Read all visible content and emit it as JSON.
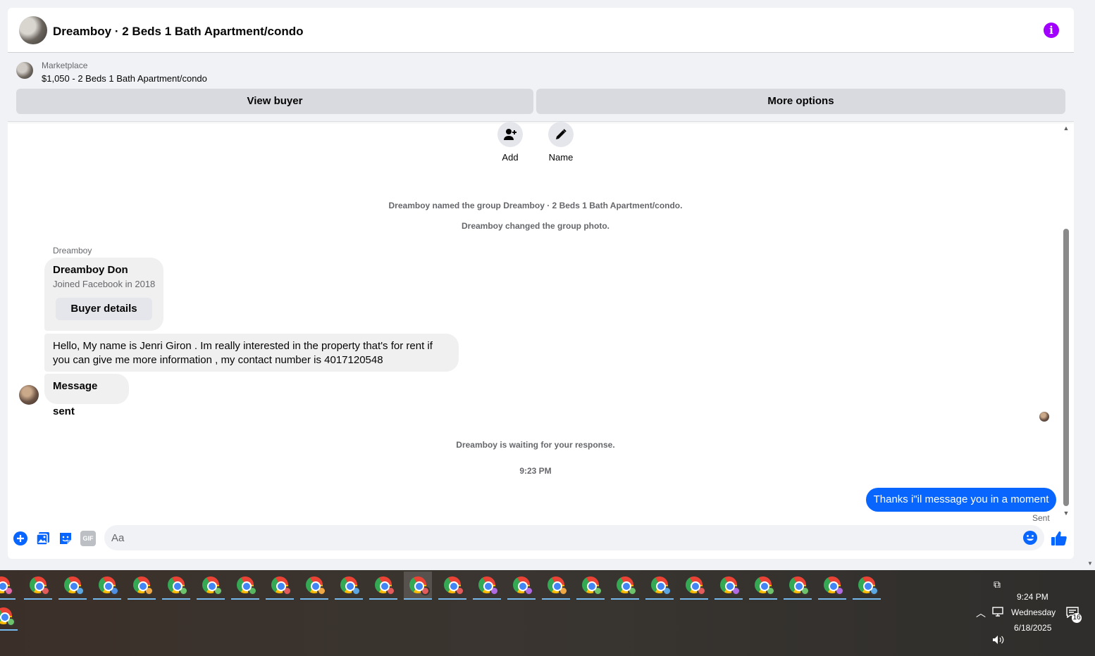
{
  "header": {
    "title": "Dreamboy · 2 Beds 1 Bath Apartment/condo",
    "info_icon": "i"
  },
  "listing": {
    "source": "Marketplace",
    "price_title": "$1,050 - 2 Beds 1 Bath Apartment/condo",
    "view_buyer_label": "View buyer",
    "more_options_label": "More options"
  },
  "quick_actions": {
    "add_label": "Add",
    "name_label": "Name"
  },
  "system": {
    "named_group": "Dreamboy named the group Dreamboy · 2 Beds 1 Bath Apartment/condo.",
    "changed_photo": "Dreamboy changed the group photo.",
    "waiting": "Dreamboy is waiting for your response.",
    "timestamp": "9:23 PM"
  },
  "thread": {
    "sender_name": "Dreamboy",
    "card": {
      "name": "Dreamboy Don",
      "joined": "Joined Facebook in 2018",
      "button": "Buyer details"
    },
    "incoming_message": "Hello, My name is Jenri Giron . Im really interested in the property that's for rent if you can give me more information , my contact number is 4017120548",
    "message_sent": "Message sent",
    "outgoing_message": "Thanks i\"il message you in a moment",
    "outgoing_status": "Sent"
  },
  "composer": {
    "placeholder": "Aa",
    "gif_label": "GIF"
  },
  "taskbar": {
    "time": "9:24 PM",
    "day": "Wednesday",
    "date": "6/18/2025",
    "notification_count": "16",
    "profile_colors": [
      "#e46aa8",
      "#e35b5b",
      "#5ba7e3",
      "#4f8fe3",
      "#f0a844",
      "#6cc36c",
      "#6cc36c",
      "#57b65f",
      "#e35b5b",
      "#f0a844",
      "#5ba7e3",
      "#e35b5b",
      "#e35b5b",
      "#e35b5b",
      "#b06ae4",
      "#b06ae4",
      "#f0a844",
      "#6cc36c",
      "#6cc36c",
      "#5ba7e3",
      "#e35b5b",
      "#b06ae4",
      "#6cc36c",
      "#6cc36c",
      "#b06ae4",
      "#5ba7e3",
      "#6cc36c"
    ]
  },
  "colors": {
    "accent_blue": "#0866ff",
    "info_purple": "#a100ff"
  }
}
